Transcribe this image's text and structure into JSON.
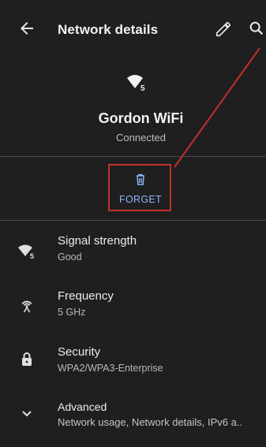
{
  "appbar": {
    "title": "Network details"
  },
  "network": {
    "name": "Gordon WiFi",
    "status": "Connected"
  },
  "actions": {
    "forget_label": "FORGET"
  },
  "rows": [
    {
      "title": "Signal strength",
      "subtitle": "Good",
      "icon": "wifi-5-icon"
    },
    {
      "title": "Frequency",
      "subtitle": "5 GHz",
      "icon": "antenna-icon"
    },
    {
      "title": "Security",
      "subtitle": "WPA2/WPA3-Enterprise",
      "icon": "lock-icon"
    },
    {
      "title": "Advanced",
      "subtitle": "Network usage, Network details, IPv6 a..",
      "icon": "chevron-down-icon"
    }
  ],
  "colors": {
    "background": "#1f1f1f",
    "accent": "#8ab4f8",
    "annotation": "#c0302a"
  }
}
